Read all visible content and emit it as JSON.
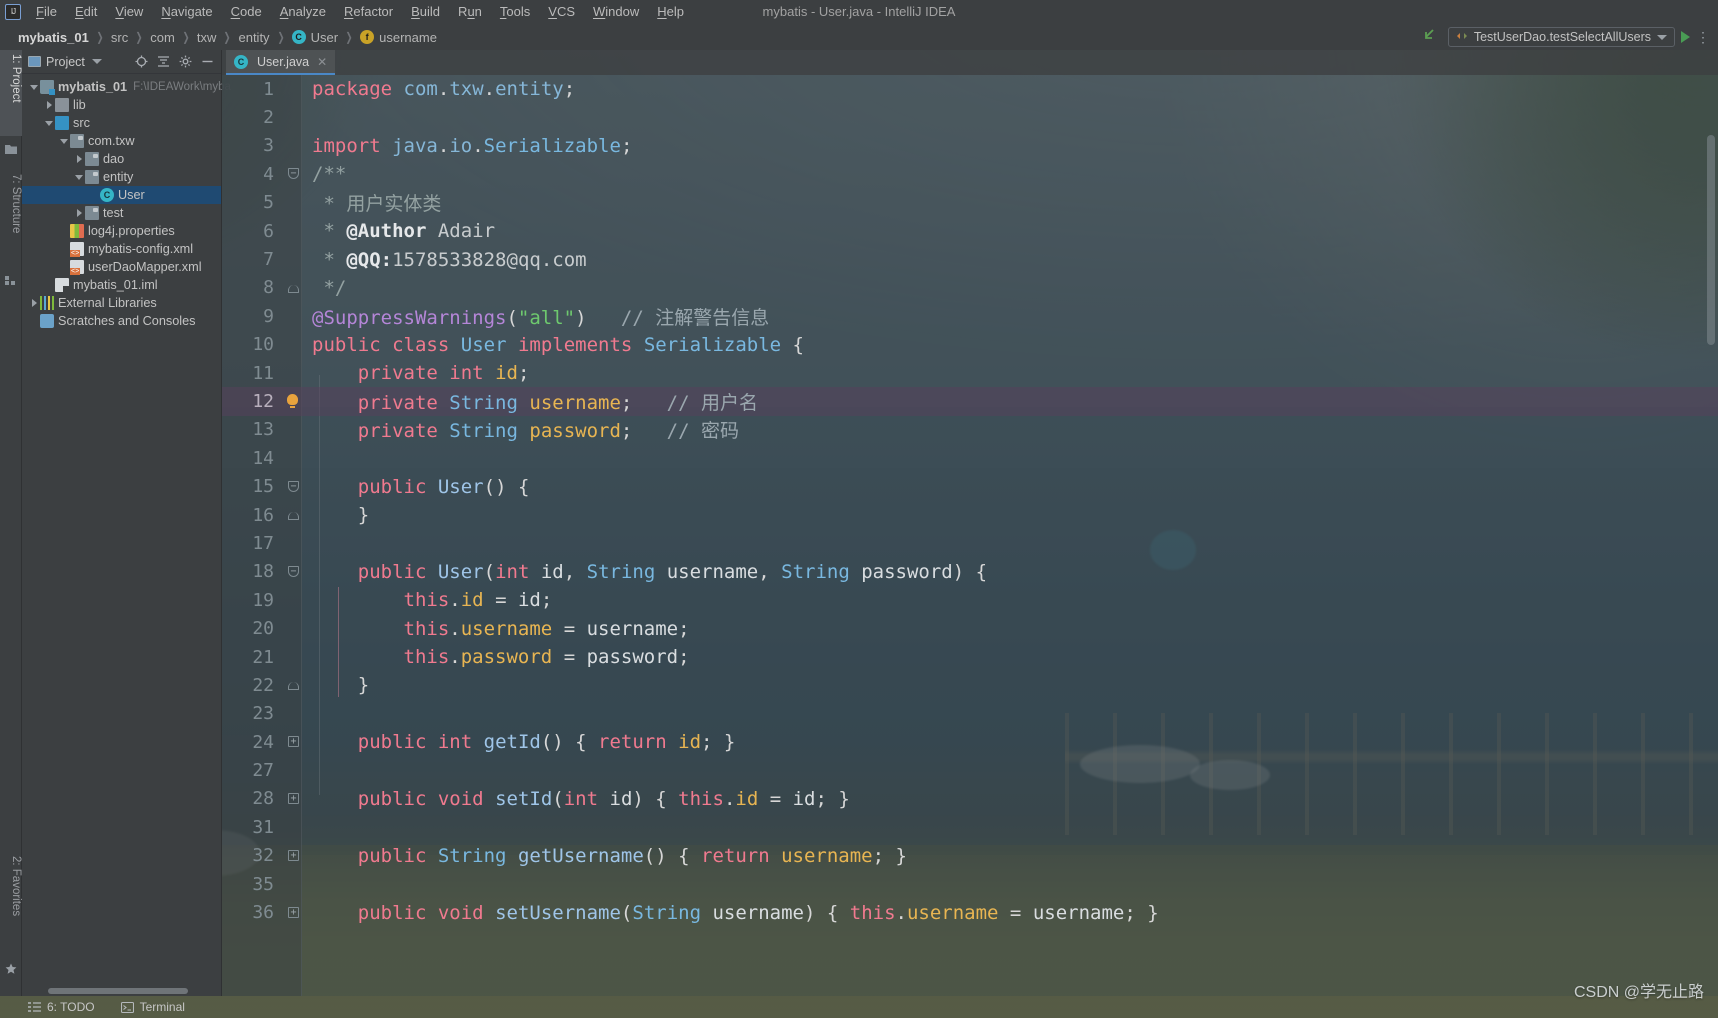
{
  "window": {
    "title": "mybatis - User.java - IntelliJ IDEA",
    "logo": "IJ"
  },
  "menubar": {
    "items": [
      {
        "label": "File",
        "mnemonic": "F"
      },
      {
        "label": "Edit",
        "mnemonic": "E"
      },
      {
        "label": "View",
        "mnemonic": "V"
      },
      {
        "label": "Navigate",
        "mnemonic": "N"
      },
      {
        "label": "Code",
        "mnemonic": "C"
      },
      {
        "label": "Analyze",
        "mnemonic": "A"
      },
      {
        "label": "Refactor",
        "mnemonic": "R"
      },
      {
        "label": "Build",
        "mnemonic": "B"
      },
      {
        "label": "Run",
        "mnemonic": "u"
      },
      {
        "label": "Tools",
        "mnemonic": "T"
      },
      {
        "label": "VCS",
        "mnemonic": "V"
      },
      {
        "label": "Window",
        "mnemonic": "W"
      },
      {
        "label": "Help",
        "mnemonic": "H"
      }
    ]
  },
  "breadcrumb": {
    "items": [
      {
        "label": "mybatis_01",
        "icon": "none",
        "bold": true
      },
      {
        "label": "src",
        "icon": "none",
        "bold": false
      },
      {
        "label": "com",
        "icon": "none",
        "bold": false
      },
      {
        "label": "txw",
        "icon": "none",
        "bold": false
      },
      {
        "label": "entity",
        "icon": "none",
        "bold": false
      },
      {
        "label": "User",
        "icon": "class-icon",
        "bold": false
      },
      {
        "label": "username",
        "icon": "field-icon",
        "bold": false
      }
    ],
    "separator": "❯"
  },
  "run_toolbar": {
    "back_arrow_icon": "back-arrow-icon",
    "configuration": "TestUserDao.testSelectAllUsers",
    "config_icon": "run-config-icon",
    "dropdown_icon": "chevron-down-icon",
    "run_icon": "run-button-icon",
    "more_icon": "more-options-icon"
  },
  "left_toolstrip": {
    "top_tabs": [
      {
        "label": "1: Project",
        "mnemonic": "1",
        "icon": "project-folder-icon",
        "active": true
      },
      {
        "label": "7: Structure",
        "mnemonic": "7",
        "icon": "structure-icon",
        "active": false
      }
    ],
    "bottom_tabs": [
      {
        "label": "2: Favorites",
        "mnemonic": "2",
        "icon": "star-icon",
        "active": false
      }
    ]
  },
  "project_panel": {
    "header": {
      "title": "Project",
      "folder_icon": "project-window-icon",
      "dropdown_icon": "chevron-down-icon",
      "locate_icon": "scroll-from-source-icon",
      "collapse_icon": "collapse-all-icon",
      "settings_icon": "gear-icon",
      "hide_icon": "hide-icon"
    },
    "tree": [
      {
        "label": "mybatis_01",
        "secondary": "F:\\IDEAWork\\myba",
        "icon": "module-icon",
        "indent": 0,
        "twisty": "down",
        "bold": true,
        "selected": false
      },
      {
        "label": "lib",
        "secondary": "",
        "icon": "folder-icon",
        "indent": 1,
        "twisty": "right",
        "bold": false,
        "selected": false
      },
      {
        "label": "src",
        "secondary": "",
        "icon": "source-folder-icon",
        "indent": 1,
        "twisty": "down",
        "bold": false,
        "selected": false
      },
      {
        "label": "com.txw",
        "secondary": "",
        "icon": "package-icon",
        "indent": 2,
        "twisty": "down",
        "bold": false,
        "selected": false
      },
      {
        "label": "dao",
        "secondary": "",
        "icon": "package-icon",
        "indent": 3,
        "twisty": "right",
        "bold": false,
        "selected": false
      },
      {
        "label": "entity",
        "secondary": "",
        "icon": "package-icon",
        "indent": 3,
        "twisty": "down",
        "bold": false,
        "selected": false
      },
      {
        "label": "User",
        "secondary": "",
        "icon": "class-icon",
        "indent": 4,
        "twisty": "none",
        "bold": false,
        "selected": true
      },
      {
        "label": "test",
        "secondary": "",
        "icon": "package-icon",
        "indent": 3,
        "twisty": "right",
        "bold": false,
        "selected": false
      },
      {
        "label": "log4j.properties",
        "secondary": "",
        "icon": "properties-file-icon",
        "indent": 2,
        "twisty": "none",
        "bold": false,
        "selected": false
      },
      {
        "label": "mybatis-config.xml",
        "secondary": "",
        "icon": "xml-file-icon",
        "indent": 2,
        "twisty": "none",
        "bold": false,
        "selected": false
      },
      {
        "label": "userDaoMapper.xml",
        "secondary": "",
        "icon": "xml-file-icon",
        "indent": 2,
        "twisty": "none",
        "bold": false,
        "selected": false
      },
      {
        "label": "mybatis_01.iml",
        "secondary": "",
        "icon": "iml-file-icon",
        "indent": 1,
        "twisty": "none",
        "bold": false,
        "selected": false
      },
      {
        "label": "External Libraries",
        "secondary": "",
        "icon": "libraries-icon",
        "indent": 0,
        "twisty": "right",
        "bold": false,
        "selected": false
      },
      {
        "label": "Scratches and Consoles",
        "secondary": "",
        "icon": "scratches-icon",
        "indent": 0,
        "twisty": "none",
        "bold": false,
        "selected": false
      }
    ]
  },
  "editor": {
    "tab": {
      "label": "User.java",
      "icon": "class-icon",
      "close_icon": "close-icon"
    },
    "lines": [
      {
        "num": "1",
        "marker": "none",
        "text": "package com.txw.entity;"
      },
      {
        "num": "2",
        "marker": "none",
        "text": ""
      },
      {
        "num": "3",
        "marker": "none",
        "text": "import java.io.Serializable;"
      },
      {
        "num": "4",
        "marker": "fold-open",
        "text": "/**"
      },
      {
        "num": "5",
        "marker": "none",
        "text": " * 用户实体类"
      },
      {
        "num": "6",
        "marker": "none",
        "text": " * @Author Adair"
      },
      {
        "num": "7",
        "marker": "none",
        "text": " * @QQ:1578533828@qq.com"
      },
      {
        "num": "8",
        "marker": "fold-close",
        "text": " */"
      },
      {
        "num": "9",
        "marker": "none",
        "text": "@SuppressWarnings(\"all\")   // 注解警告信息"
      },
      {
        "num": "10",
        "marker": "none",
        "text": "public class User implements Serializable {"
      },
      {
        "num": "11",
        "marker": "none",
        "text": "    private int id;"
      },
      {
        "num": "12",
        "marker": "bulb",
        "text": "    private String username;   // 用户名"
      },
      {
        "num": "13",
        "marker": "none",
        "text": "    private String password;   // 密码"
      },
      {
        "num": "14",
        "marker": "none",
        "text": ""
      },
      {
        "num": "15",
        "marker": "fold-open",
        "text": "    public User() {"
      },
      {
        "num": "16",
        "marker": "fold-close",
        "text": "    }"
      },
      {
        "num": "17",
        "marker": "none",
        "text": ""
      },
      {
        "num": "18",
        "marker": "fold-open",
        "text": "    public User(int id, String username, String password) {"
      },
      {
        "num": "19",
        "marker": "none",
        "text": "        this.id = id;"
      },
      {
        "num": "20",
        "marker": "none",
        "text": "        this.username = username;"
      },
      {
        "num": "21",
        "marker": "none",
        "text": "        this.password = password;"
      },
      {
        "num": "22",
        "marker": "fold-close",
        "text": "    }"
      },
      {
        "num": "23",
        "marker": "none",
        "text": ""
      },
      {
        "num": "24",
        "marker": "fold-plus",
        "text": "    public int getId() { return id; }"
      },
      {
        "num": "27",
        "marker": "none",
        "text": ""
      },
      {
        "num": "28",
        "marker": "fold-plus",
        "text": "    public void setId(int id) { this.id = id; }"
      },
      {
        "num": "31",
        "marker": "none",
        "text": ""
      },
      {
        "num": "32",
        "marker": "fold-plus",
        "text": "    public String getUsername() { return username; }"
      },
      {
        "num": "35",
        "marker": "none",
        "text": ""
      },
      {
        "num": "36",
        "marker": "fold-plus",
        "text": "    public void setUsername(String username) { this.username = username; }"
      }
    ],
    "highlighted_line": "12"
  },
  "statusbar": {
    "items": [
      {
        "label": "6: TODO",
        "mnemonic": "6",
        "icon": "todo-icon"
      },
      {
        "label": "Terminal",
        "mnemonic": "",
        "icon": "terminal-icon"
      }
    ]
  },
  "watermark": "CSDN @学无止路",
  "colors": {
    "accent": "#4a88c7",
    "selection": "#1f4a72",
    "keyword": "#f07a8f",
    "string": "#6ec96e",
    "comment": "#93a1a1",
    "annotation": "#b586d8",
    "type": "#79b8e0",
    "field": "#e8b552",
    "method": "#9fc5e8",
    "bulb": "#e8a33d",
    "run_green": "#499c54"
  }
}
